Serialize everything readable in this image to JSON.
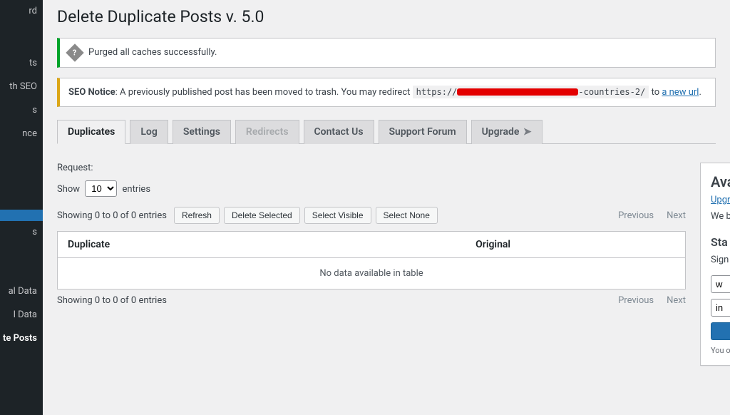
{
  "sidebar": {
    "items": [
      "rd",
      "",
      "ts",
      "th SEO",
      "s",
      "nce",
      "",
      "s",
      "",
      "al Data",
      "l Data",
      "te Posts"
    ],
    "active_index": 6
  },
  "page_title": "Delete Duplicate Posts v. 5.0",
  "notice_success": {
    "text": "Purged all caches successfully."
  },
  "notice_seo": {
    "label": "SEO Notice",
    "text_before": ": A previously published post has been moved to trash. You may redirect ",
    "url_prefix": "https://",
    "url_suffix": "-countries-2/",
    "text_middle": " to ",
    "link_text": "a new url",
    "text_after": "."
  },
  "tabs": [
    {
      "label": "Duplicates",
      "active": true
    },
    {
      "label": "Log"
    },
    {
      "label": "Settings"
    },
    {
      "label": "Redirects",
      "disabled": true
    },
    {
      "label": "Contact Us"
    },
    {
      "label": "Support Forum"
    },
    {
      "label": "Upgrade",
      "arrow": true
    }
  ],
  "request_label": "Request:",
  "length": {
    "prefix": "Show",
    "value": "10",
    "suffix": "entries"
  },
  "info": "Showing 0 to 0 of 0 entries",
  "buttons": {
    "refresh": "Refresh",
    "delete_selected": "Delete Selected",
    "select_visible": "Select Visible",
    "select_none": "Select None"
  },
  "pager": {
    "prev": "Previous",
    "next": "Next"
  },
  "table": {
    "col_duplicate": "Duplicate",
    "col_original": "Original",
    "empty": "No data available in table"
  },
  "right": {
    "heading": "Available",
    "upg_link": "Upgrade",
    "p1": "We before",
    "heading2": "Sta",
    "p2": "Sign direct Wor dup",
    "in1_placeholder": "w",
    "in2_placeholder": "in",
    "small": "You o our E"
  }
}
